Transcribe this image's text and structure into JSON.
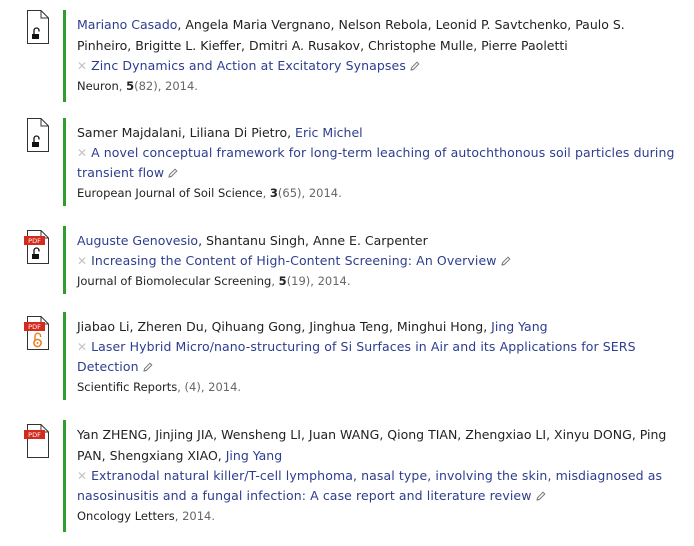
{
  "publications": [
    {
      "icon": "lock-open-icon",
      "pdf": false,
      "authors": [
        {
          "name": "Mariano Casado",
          "link": true
        },
        {
          "name": "Angela Maria Vergnano",
          "link": false
        },
        {
          "name": "Nelson Rebola",
          "link": false
        },
        {
          "name": "Leonid P. Savtchenko",
          "link": false
        },
        {
          "name": "Paulo S. Pinheiro",
          "link": false
        },
        {
          "name": "Brigitte L. Kieffer",
          "link": false
        },
        {
          "name": "Dmitri A. Rusakov",
          "link": false
        },
        {
          "name": "Christophe Mulle",
          "link": false
        },
        {
          "name": "Pierre Paoletti",
          "link": false
        }
      ],
      "title": "Zinc Dynamics and Action at Excitatory Synapses",
      "journal": "Neuron",
      "volume": "5",
      "issue": "(82)",
      "year": "2014."
    },
    {
      "icon": "lock-open-icon",
      "pdf": false,
      "authors": [
        {
          "name": "Samer Majdalani",
          "link": false
        },
        {
          "name": "Liliana Di Pietro",
          "link": false
        },
        {
          "name": "Eric Michel",
          "link": true
        }
      ],
      "title": "A novel conceptual framework for long-term leaching of autochthonous soil particles during transient flow",
      "journal": "European Journal of Soil Science",
      "volume": "3",
      "issue": "(65)",
      "year": "2014."
    },
    {
      "icon": "pdf-lock-open-icon",
      "pdf": true,
      "pdf_label": "PDF",
      "authors": [
        {
          "name": "Auguste Genovesio",
          "link": true
        },
        {
          "name": "Shantanu Singh",
          "link": false
        },
        {
          "name": "Anne E. Carpenter",
          "link": false
        }
      ],
      "title": "Increasing the Content of High-Content Screening: An Overview",
      "journal": "Journal of Biomolecular Screening",
      "volume": "5",
      "issue": "(19)",
      "year": "2014."
    },
    {
      "icon": "pdf-open-access-icon",
      "pdf": true,
      "pdf_label": "PDF",
      "authors": [
        {
          "name": "Jiabao Li",
          "link": false
        },
        {
          "name": "Zheren Du",
          "link": false
        },
        {
          "name": "Qihuang Gong",
          "link": false
        },
        {
          "name": "Jinghua Teng",
          "link": false
        },
        {
          "name": "Minghui Hong",
          "link": false
        },
        {
          "name": "Jing Yang",
          "link": true
        }
      ],
      "title": "Laser Hybrid Micro/nano-structuring of Si Surfaces in Air and its Applications for SERS Detection",
      "journal": "Scientific Reports",
      "volume": "",
      "issue": "(4)",
      "year": "2014."
    },
    {
      "icon": "pdf-icon",
      "pdf": true,
      "pdf_label": "PDF",
      "authors": [
        {
          "name": "Yan ZHENG",
          "link": false
        },
        {
          "name": "Jinjing JIA",
          "link": false
        },
        {
          "name": "Wensheng LI",
          "link": false
        },
        {
          "name": "Juan WANG",
          "link": false
        },
        {
          "name": "Qiong TIAN",
          "link": false
        },
        {
          "name": "Zhengxiao LI",
          "link": false
        },
        {
          "name": "Xinyu DONG",
          "link": false
        },
        {
          "name": "Ping PAN",
          "link": false
        },
        {
          "name": "Shengxiang XIAO",
          "link": false
        },
        {
          "name": "Jing Yang",
          "link": true
        }
      ],
      "title": "Extranodal natural killer/T-cell lymphoma, nasal type, involving the skin, misdiagnosed as nasosinusitis and a fungal infection: A case report and literature review",
      "journal": "Oncology Letters",
      "volume": "",
      "issue": "",
      "year": "2014."
    }
  ],
  "remove_symbol": "✕",
  "colors": {
    "accent_bar": "#2e9e2e",
    "link": "#2d3d8f",
    "pdf_badge": "#d42b1e",
    "open_access": "#e8842a"
  }
}
